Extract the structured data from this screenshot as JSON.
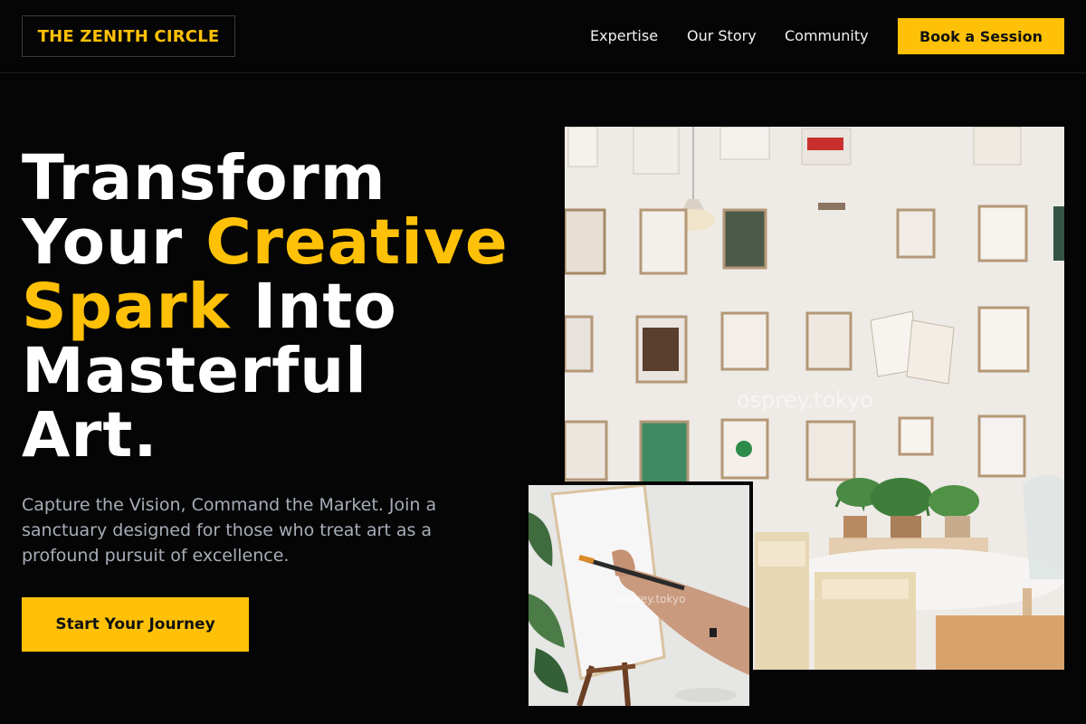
{
  "header": {
    "logo": "THE ZENITH CIRCLE",
    "nav": [
      "Expertise",
      "Our Story",
      "Community"
    ],
    "cta": "Book a Session"
  },
  "hero": {
    "headline": {
      "line1": "Transform",
      "line2_a": "Your ",
      "line2_b": "Creative",
      "line3_a": "Spark",
      "line3_b": " Into",
      "line4": "Masterful",
      "line5": "Art."
    },
    "subtext": "Capture the Vision, Command the Market. Join a sanctuary designed for those who treat art as a profound pursuit of excellence.",
    "cta": "Start Your Journey"
  },
  "images": {
    "main": "studio-wall-photo",
    "inset": "painting-easel-photo"
  },
  "colors": {
    "accent": "#FFC107",
    "background": "#050505",
    "muted_text": "#a7adb8"
  }
}
